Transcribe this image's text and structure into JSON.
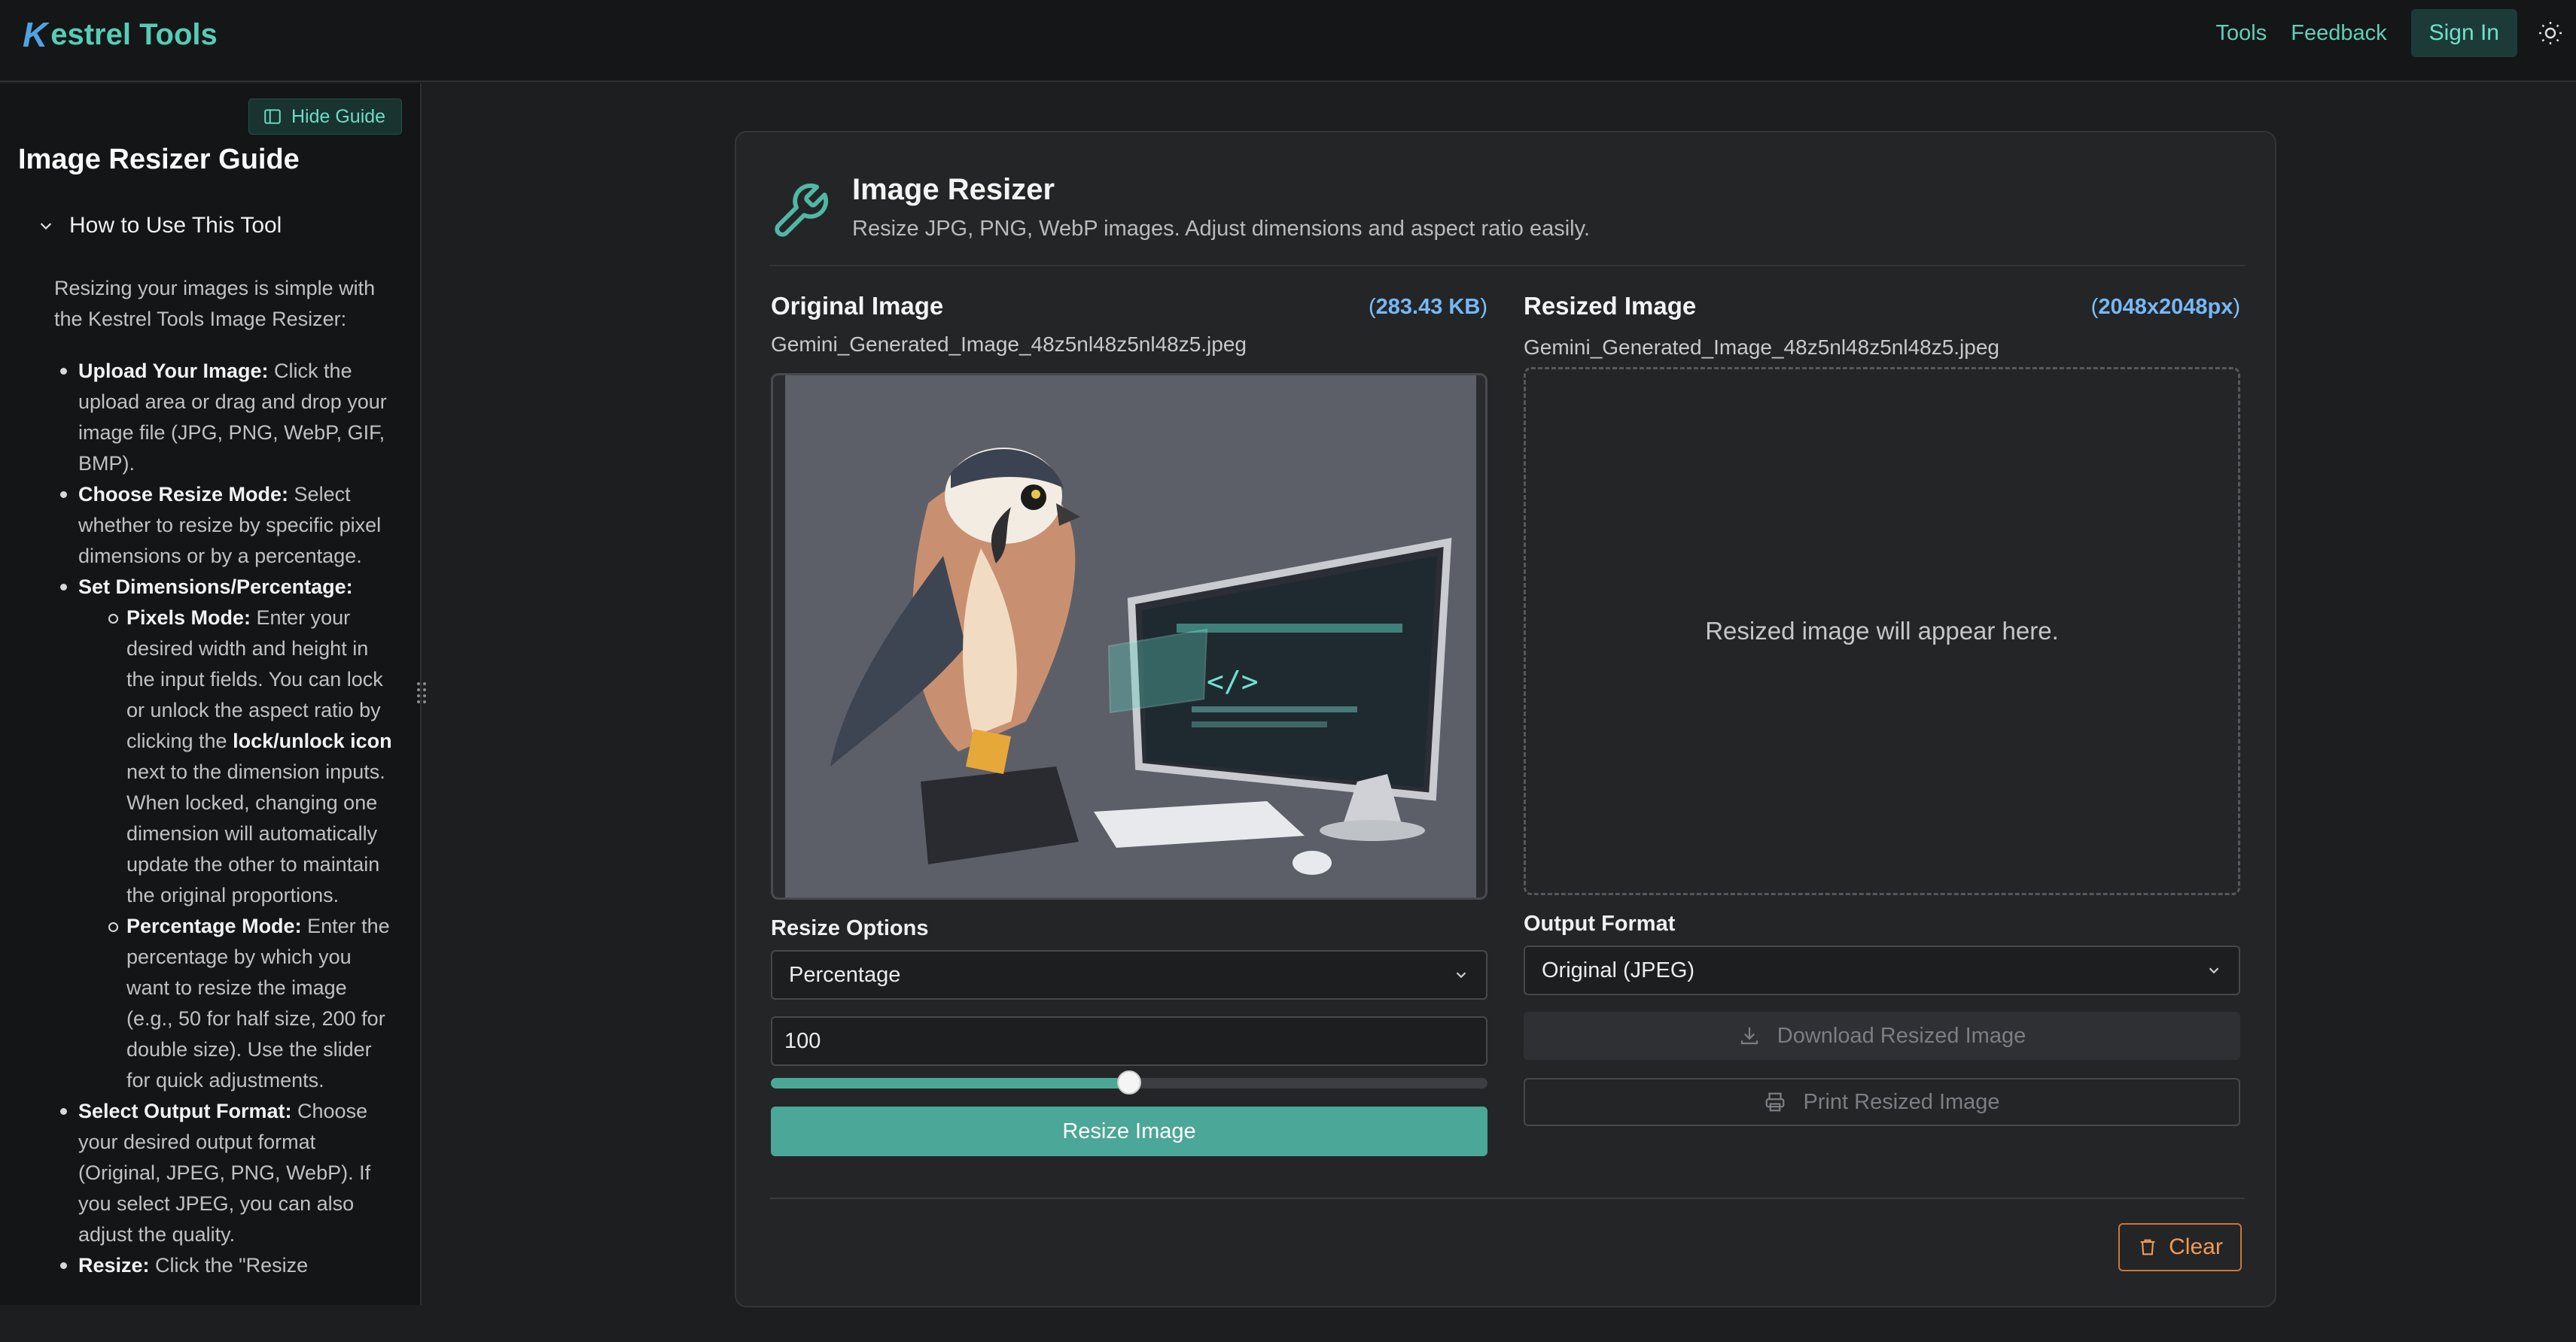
{
  "header": {
    "brand_initial": "K",
    "brand_rest": "estrel Tools",
    "nav": {
      "tools": "Tools",
      "feedback": "Feedback",
      "sign_in": "Sign In"
    },
    "theme_icon": "sun-icon"
  },
  "sidebar": {
    "hide_button": "Hide Guide",
    "title": "Image Resizer Guide",
    "accordion_label": "How to Use This Tool",
    "intro": "Resizing your images is simple with the Kestrel Tools Image Resizer:",
    "steps": [
      {
        "bold": "Upload Your Image:",
        "text": " Click the upload area or drag and drop your image file (JPG, PNG, WebP, GIF, BMP)."
      },
      {
        "bold": "Choose Resize Mode:",
        "text": " Select whether to resize by specific pixel dimensions or by a percentage."
      },
      {
        "bold": "Set Dimensions/Percentage:",
        "text": ""
      },
      {
        "bold": "Select Output Format:",
        "text": " Choose your desired output format (Original, JPEG, PNG, WebP). If you select JPEG, you can also adjust the quality."
      },
      {
        "bold": "Resize:",
        "text": " Click the \"Resize"
      }
    ],
    "substeps": [
      {
        "bold": "Pixels Mode:",
        "text_a": " Enter your desired width and height in the input fields. You can lock or unlock the aspect ratio by clicking the ",
        "bold_b": "lock/unlock icon",
        "text_b": " next to the dimension inputs. When locked, changing one dimension will automatically update the other to maintain the original proportions."
      },
      {
        "bold": "Percentage Mode:",
        "text": " Enter the percentage by which you want to resize the image (e.g., 50 for half size, 200 for double size). Use the slider for quick adjustments."
      }
    ]
  },
  "card": {
    "title": "Image Resizer",
    "subtitle": "Resize JPG, PNG, WebP images. Adjust dimensions and aspect ratio easily.",
    "original": {
      "title": "Original Image",
      "meta_open": "(",
      "meta_value": "283.43 KB",
      "meta_close": ")",
      "file_name": "Gemini_Generated_Image_48z5nl48z5nl48z5.jpeg"
    },
    "resized": {
      "title": "Resized Image",
      "meta_open": "(",
      "meta_value": "2048x2048px",
      "meta_close": ")",
      "file_name": "Gemini_Generated_Image_48z5nl48z5nl48z5.jpeg",
      "placeholder": "Resized image will appear here."
    },
    "resize_options_label": "Resize Options",
    "resize_mode": "Percentage",
    "percentage_value": "100",
    "slider_fraction": 0.5,
    "resize_button": "Resize Image",
    "output_format_label": "Output Format",
    "output_format": "Original (JPEG)",
    "download_button": "Download Resized Image",
    "print_button": "Print Resized Image",
    "clear_button": "Clear"
  },
  "colors": {
    "accent": "#4ba797",
    "brand": "#55cdb4",
    "link_blue": "#76b8f5",
    "danger": "#f39a52"
  }
}
